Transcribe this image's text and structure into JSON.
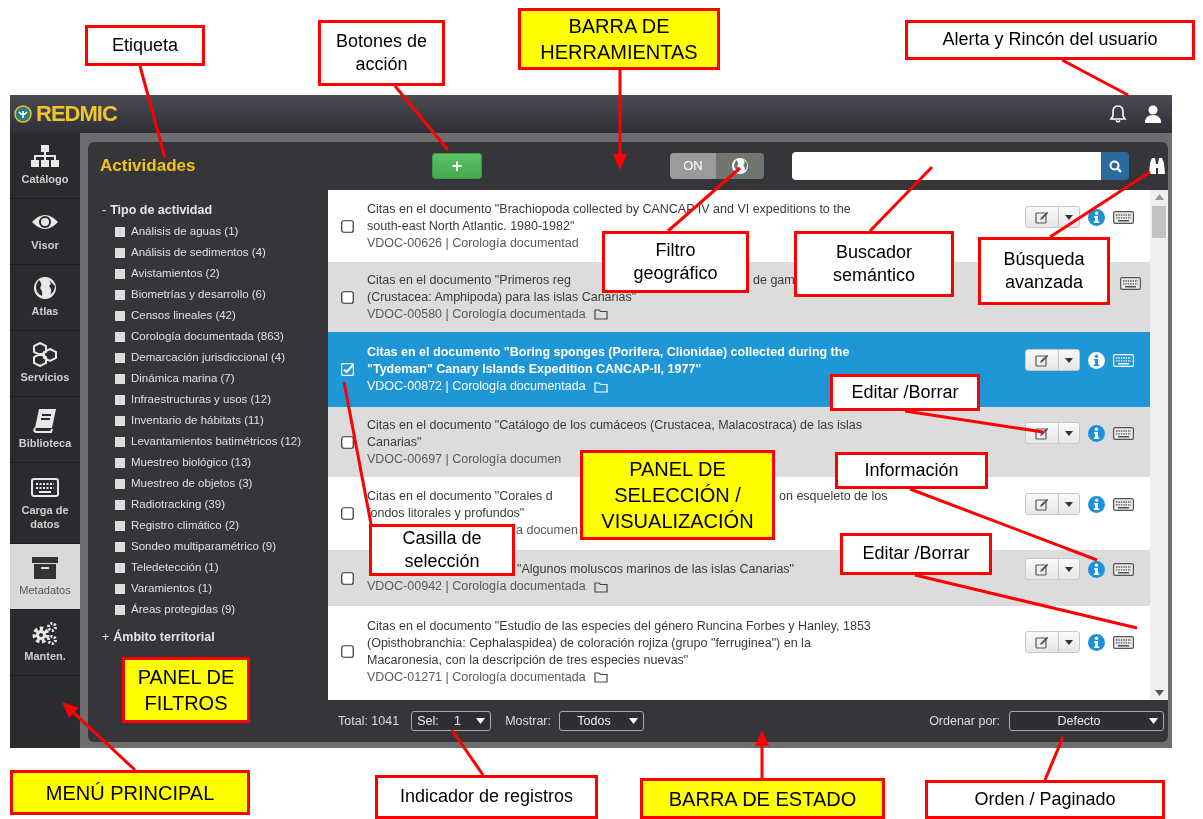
{
  "app": {
    "logo": "REDMIC"
  },
  "nav": [
    {
      "label": "Catálogo",
      "selected": false
    },
    {
      "label": "Visor",
      "selected": false
    },
    {
      "label": "Atlas",
      "selected": false
    },
    {
      "label": "Servicios",
      "selected": false
    },
    {
      "label": "Biblioteca",
      "selected": false
    },
    {
      "label": "Carga de datos",
      "selected": false
    },
    {
      "label": "Metadatos",
      "selected": true
    },
    {
      "label": "Manten.",
      "selected": false
    }
  ],
  "panel": {
    "title": "Actividades",
    "add_button": "+",
    "geo_filter": {
      "label": "ON",
      "on": true
    }
  },
  "filters": [
    {
      "marker": "-",
      "label": "Tipo de actividad",
      "options": [
        {
          "label": "Análisis de aguas (1)",
          "checked": false
        },
        {
          "label": "Análisis de sedimentos (4)",
          "checked": false
        },
        {
          "label": "Avistamientos (2)",
          "checked": false
        },
        {
          "label": "Biometrías y desarrollo (6)",
          "checked": false
        },
        {
          "label": "Censos lineales (42)",
          "checked": false
        },
        {
          "label": "Corología documentada (863)",
          "checked": false
        },
        {
          "label": "Demarcación jurisdiccional (4)",
          "checked": false
        },
        {
          "label": "Dinámica marina (7)",
          "checked": false
        },
        {
          "label": "Infraestructuras y usos (12)",
          "checked": false
        },
        {
          "label": "Inventario de hábitats (11)",
          "checked": false
        },
        {
          "label": "Levantamientos batimétricos (12)",
          "checked": false
        },
        {
          "label": "Muestreo biológico (13)",
          "checked": false
        },
        {
          "label": "Muestreo de objetos (3)",
          "checked": false
        },
        {
          "label": "Radiotracking (39)",
          "checked": false
        },
        {
          "label": "Registro climático (2)",
          "checked": false
        },
        {
          "label": "Sondeo multiparamétrico (9)",
          "checked": false
        },
        {
          "label": "Teledetección (1)",
          "checked": false
        },
        {
          "label": "Varamientos (1)",
          "checked": false
        },
        {
          "label": "Áreas protegidas (9)",
          "checked": false
        }
      ]
    },
    {
      "marker": "+",
      "label": "Ámbito territorial"
    }
  ],
  "rows": [
    {
      "selected": false,
      "title": [
        [
          "Citas en el documento \"Brachiopoda collected by CANCAP IV and VI expeditions to the"
        ],
        [
          "south-east North Atlantic. 1980-1982\""
        ]
      ],
      "meta": [
        "VDOC-00626 | Corología documentad"
      ],
      "folder_visible": false
    },
    {
      "selected": false,
      "title": [
        [
          "Citas en el documento \"Primeros reg",
          "de gam"
        ],
        [
          "(Crustacea: Amphipoda) para las islas Canarias\""
        ]
      ],
      "meta": [
        "VDOC-00580 | Corología documentada"
      ],
      "folder_visible": true
    },
    {
      "selected": true,
      "title": [
        [
          "Citas en el documento \"Boring sponges (Porifera, Clionidae) collected during the"
        ],
        [
          "\"Tydeman\" Canary Islands Expedition CANCAP-II, 1977\""
        ]
      ],
      "meta": [
        "VDOC-00872 | Corología documentada"
      ],
      "folder_visible": true
    },
    {
      "selected": false,
      "title": [
        [
          "Citas en el documento \"Catálogo de los cumáceos (Crustacea, Malacostraca) de las islas"
        ],
        [
          "Canarias\""
        ]
      ],
      "meta": [
        "VDOC-00697 | Corología documen"
      ],
      "folder_visible": false
    },
    {
      "selected": false,
      "title": [
        [
          "Citas en el documento \"Corales d",
          "on esqueleto de los"
        ],
        [
          "fondos litorales y profundos\""
        ]
      ],
      "meta": [
        "a documen"
      ],
      "folder_visible": false
    },
    {
      "selected": false,
      "title": [
        [
          "\"Algunos moluscos marinos de las islas Canarias\""
        ]
      ],
      "meta": [
        "VDOC-00942 | Corología documentada"
      ],
      "folder_visible": true
    },
    {
      "selected": false,
      "title": [
        [
          "Citas en el documento \"Estudio de las especies del género Runcina Forbes y Hanley, 1853"
        ],
        [
          "(Opisthobranchia: Cephalaspidea) de coloración rojiza (grupo \"ferruginea\") en la"
        ],
        [
          "Macaronesia, con la descripción de tres especies nuevas\""
        ]
      ],
      "meta": [
        "VDOC-01271 | Corología documentada"
      ],
      "folder_visible": true
    }
  ],
  "status_bar": {
    "total": "Total: 1041",
    "sel_label": "Sel:",
    "sel_value": "1",
    "show_label": "Mostrar:",
    "show_value": "Todos",
    "sort_label": "Ordenar por:",
    "sort_value": "Defecto"
  },
  "callouts": [
    {
      "text": "Etiqueta",
      "kind": "note"
    },
    {
      "text": "Botones de acción",
      "kind": "note"
    },
    {
      "text": "BARRA DE HERRAMIENTAS",
      "kind": "highlight"
    },
    {
      "text": "Alerta y Rincón del usuario",
      "kind": "note"
    },
    {
      "text": "Filtro geográfico",
      "kind": "note"
    },
    {
      "text": "Buscador semántico",
      "kind": "note"
    },
    {
      "text": "Búsqueda avanzada",
      "kind": "note"
    },
    {
      "text": "Editar /Borrar",
      "kind": "note"
    },
    {
      "text": "PANEL DE SELECCIÓN / VISUALIZACIÓN",
      "kind": "highlight"
    },
    {
      "text": "Información",
      "kind": "note"
    },
    {
      "text": "Casilla de selección",
      "kind": "note"
    },
    {
      "text": "Editar /Borrar",
      "kind": "note"
    },
    {
      "text": "PANEL DE FILTROS",
      "kind": "highlight"
    },
    {
      "text": "MENÚ PRINCIPAL",
      "kind": "highlight"
    },
    {
      "text": "Indicador de registros",
      "kind": "note"
    },
    {
      "text": "BARRA DE ESTADO",
      "kind": "highlight"
    },
    {
      "text": "Orden / Paginado",
      "kind": "note"
    }
  ]
}
